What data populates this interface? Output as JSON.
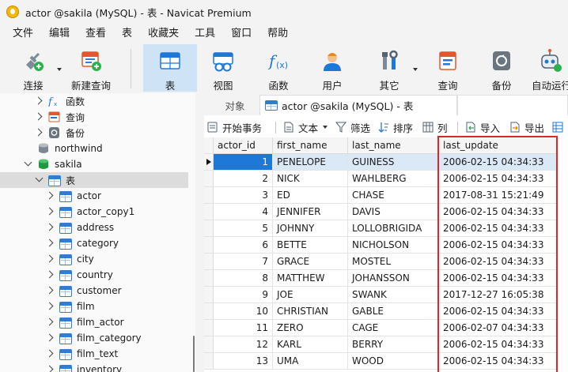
{
  "window": {
    "title": "actor @sakila (MySQL) - 表 - Navicat Premium"
  },
  "menu": [
    "文件",
    "编辑",
    "查看",
    "表",
    "收藏夹",
    "工具",
    "窗口",
    "帮助"
  ],
  "toolbar": {
    "connect": "连接",
    "new_query": "新建查询",
    "table": "表",
    "view": "视图",
    "function": "函数",
    "user": "用户",
    "other": "其它",
    "query": "查询",
    "backup": "备份",
    "automation": "自动运行"
  },
  "nav": {
    "functions": "函数",
    "queries": "查询",
    "backups": "备份",
    "db_northwind": "northwind",
    "db_sakila": "sakila",
    "tables_group": "表",
    "tables": [
      "actor",
      "actor_copy1",
      "address",
      "category",
      "city",
      "country",
      "customer",
      "film",
      "film_actor",
      "film_category",
      "film_text",
      "inventory"
    ]
  },
  "tabs": {
    "objects": "对象",
    "actor": "actor @sakila (MySQL) - 表"
  },
  "subtoolbar": {
    "begin_transaction": "开始事务",
    "text": "文本",
    "filter": "筛选",
    "sort": "排序",
    "columns": "列",
    "import": "导入",
    "export": "导出"
  },
  "grid": {
    "columns": [
      "actor_id",
      "first_name",
      "last_name",
      "last_update"
    ],
    "rows": [
      [
        "1",
        "PENELOPE",
        "GUINESS",
        "2006-02-15 04:34:33"
      ],
      [
        "2",
        "NICK",
        "WAHLBERG",
        "2006-02-15 04:34:33"
      ],
      [
        "3",
        "ED",
        "CHASE",
        "2017-08-31 15:21:49"
      ],
      [
        "4",
        "JENNIFER",
        "DAVIS",
        "2006-02-15 04:34:33"
      ],
      [
        "5",
        "JOHNNY",
        "LOLLOBRIGIDA",
        "2006-02-15 04:34:33"
      ],
      [
        "6",
        "BETTE",
        "NICHOLSON",
        "2006-02-15 04:34:33"
      ],
      [
        "7",
        "GRACE",
        "MOSTEL",
        "2006-02-15 04:34:33"
      ],
      [
        "8",
        "MATTHEW",
        "JOHANSSON",
        "2006-02-15 04:34:33"
      ],
      [
        "9",
        "JOE",
        "SWANK",
        "2017-12-27 16:05:38"
      ],
      [
        "10",
        "CHRISTIAN",
        "GABLE",
        "2006-02-15 04:34:33"
      ],
      [
        "11",
        "ZERO",
        "CAGE",
        "2006-02-07 04:34:33"
      ],
      [
        "12",
        "KARL",
        "BERRY",
        "2006-02-15 04:34:33"
      ],
      [
        "13",
        "UMA",
        "WOOD",
        "2006-02-15 04:34:33"
      ]
    ]
  }
}
